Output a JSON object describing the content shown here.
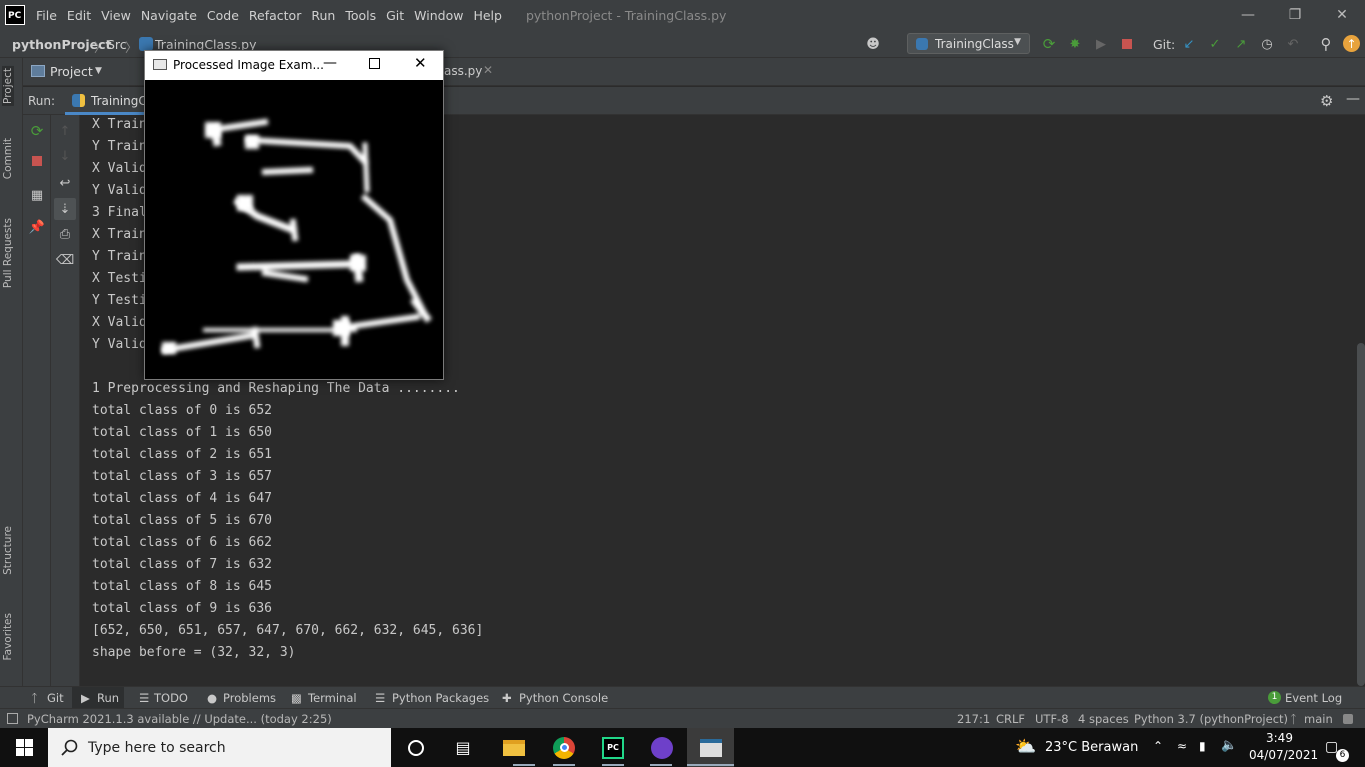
{
  "app": {
    "logo_text": "PC",
    "menu": [
      "File",
      "Edit",
      "View",
      "Navigate",
      "Code",
      "Refactor",
      "Run",
      "Tools",
      "Git",
      "Window",
      "Help"
    ],
    "window_title": "pythonProject - TrainingClass.py"
  },
  "breadcrumb": {
    "project": "pythonProject",
    "folder": "Src",
    "file": "TrainingClass.py"
  },
  "run_config": {
    "name": "TrainingClass",
    "git_label": "Git:"
  },
  "project_panel": {
    "label": "Project",
    "editor_tab_fragment": "ass.py"
  },
  "left_stripe": {
    "project": "Project",
    "commit": "Commit",
    "pull_requests": "Pull Requests",
    "structure": "Structure",
    "favorites": "Favorites"
  },
  "run_panel": {
    "label": "Run:",
    "tab": "TrainingC"
  },
  "console": {
    "hidden_lines": [
      "X Train",
      "Y Train",
      "X Valid",
      "Y Valid",
      "3 Final",
      "X Train",
      "Y Train",
      "X Testi",
      "Y Testi",
      "X Valid",
      "Y Valid"
    ],
    "lines": [
      "1 Preprocessing and Reshaping The Data ........",
      "total class of 0 is 652",
      "total class of 1 is 650",
      "total class of 2 is 651",
      "total class of 3 is 657",
      "total class of 4 is 647",
      "total class of 5 is 670",
      "total class of 6 is 662",
      "total class of 7 is 632",
      "total class of 8 is 645",
      "total class of 9 is 636",
      "[652, 650, 651, 657, 647, 670, 662, 632, 645, 636]",
      "shape before = (32, 32, 3)"
    ]
  },
  "image_window": {
    "title": "Processed Image Exam..."
  },
  "bottom_tools": {
    "git": "Git",
    "run": "Run",
    "todo": "TODO",
    "problems": "Problems",
    "terminal": "Terminal",
    "python_packages": "Python Packages",
    "python_console": "Python Console",
    "event_log": "Event Log",
    "event_count": "1"
  },
  "status": {
    "update": "PyCharm 2021.1.3 available // Update... (today 2:25)",
    "position": "217:1",
    "line_sep": "CRLF",
    "encoding": "UTF-8",
    "indent": "4 spaces",
    "interpreter": "Python 3.7 (pythonProject)",
    "branch": "main"
  },
  "taskbar": {
    "search_placeholder": "Type here to search",
    "weather": "23°C  Berawan",
    "time": "3:49",
    "date": "04/07/2021",
    "notification_count": "6"
  },
  "colors": {
    "accent_green": "#4a9c3a",
    "stop_red": "#c75450",
    "git_blue": "#3592c4"
  }
}
